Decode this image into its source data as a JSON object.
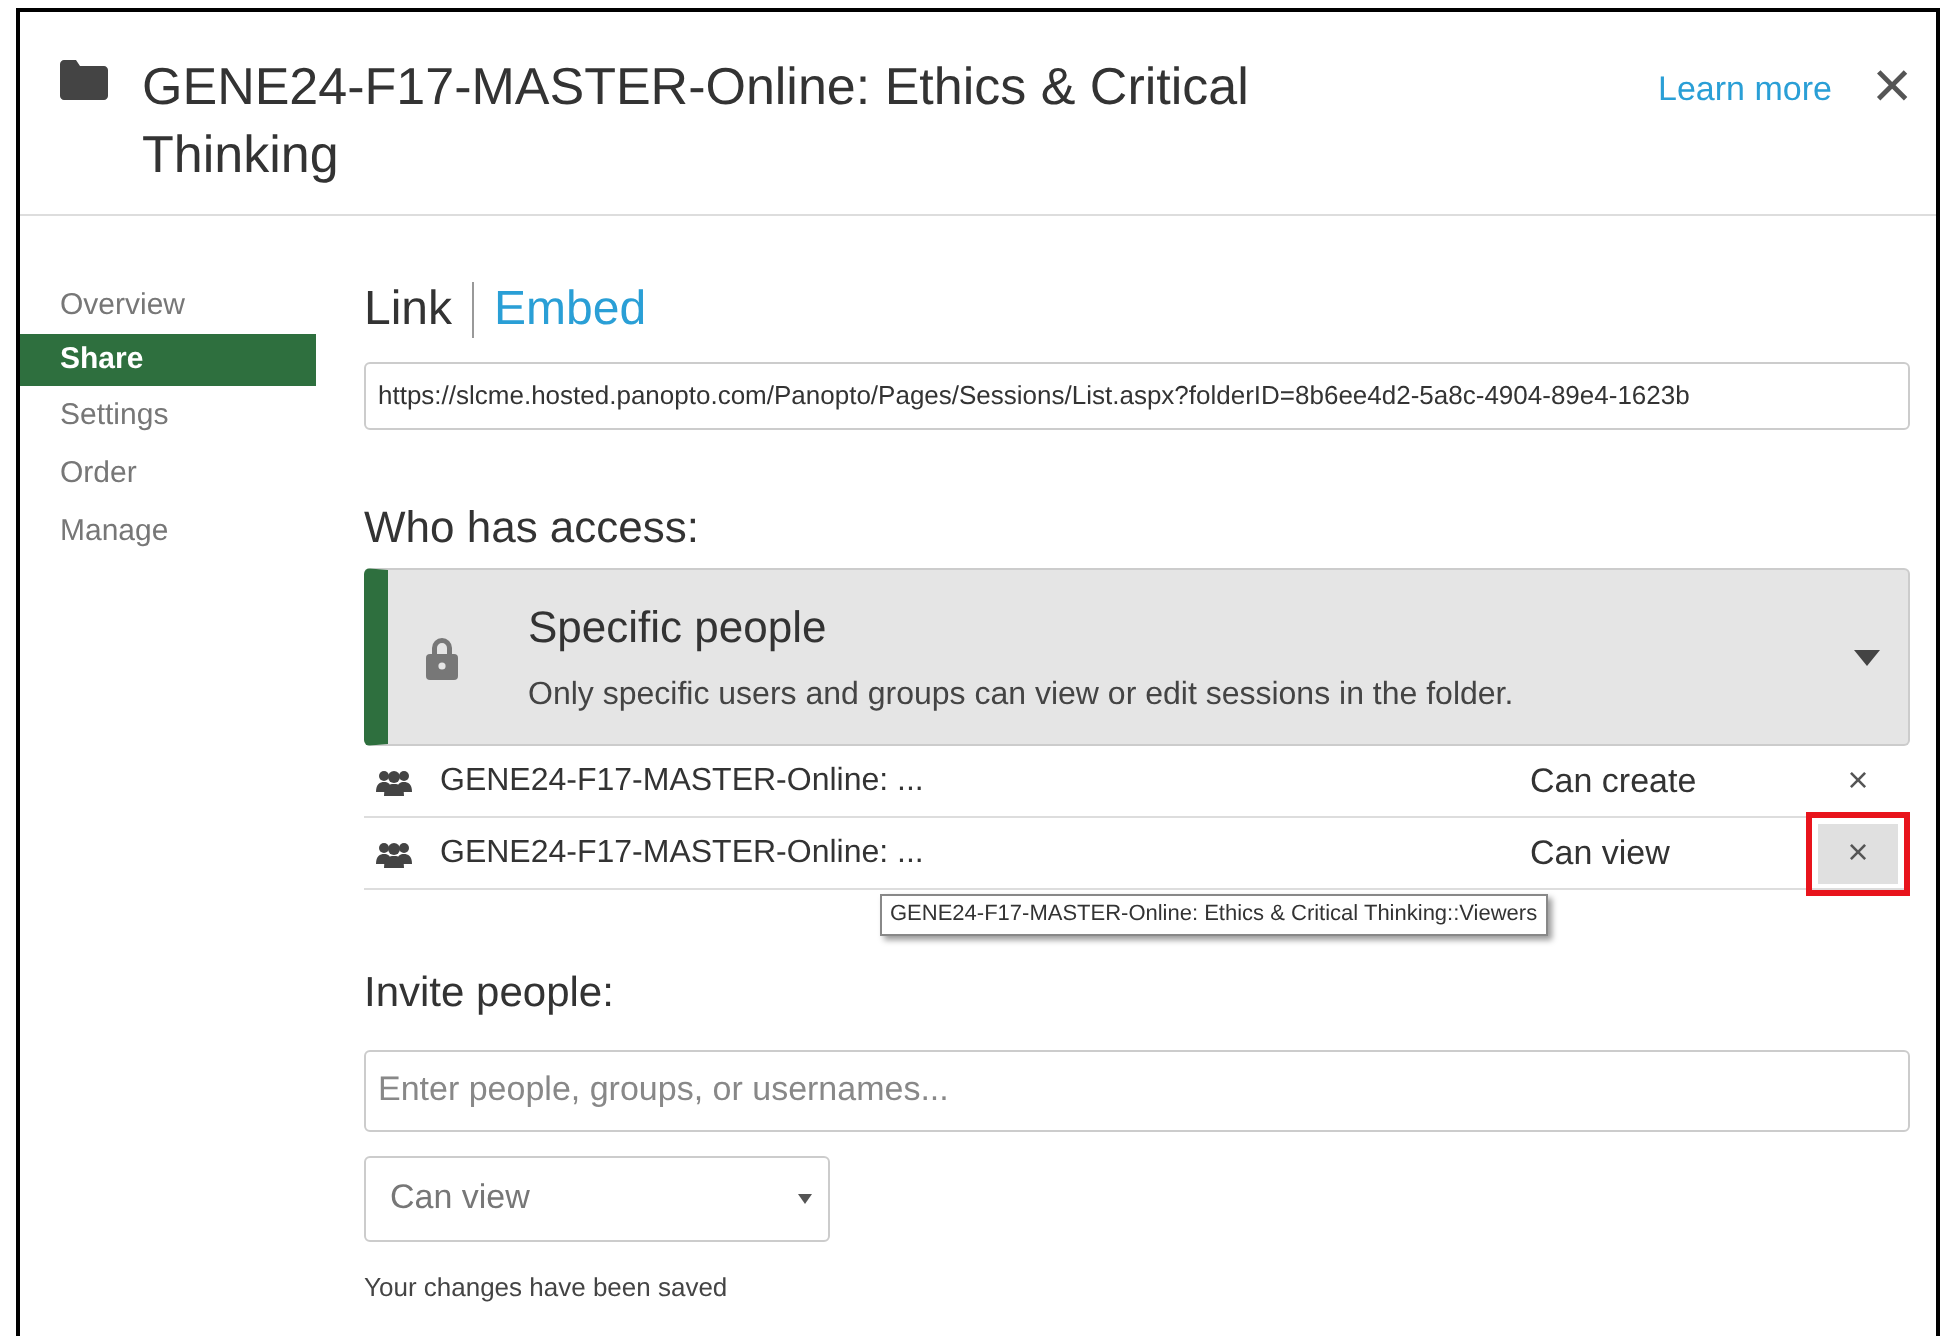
{
  "dialog": {
    "title": "GENE24-F17-MASTER-Online: Ethics & Critical Thinking",
    "learn_more": "Learn more",
    "close": "×"
  },
  "sidebar": {
    "items": [
      {
        "label": "Overview",
        "selected": false
      },
      {
        "label": "Share",
        "selected": true
      },
      {
        "label": "Settings",
        "selected": false
      },
      {
        "label": "Order",
        "selected": false
      },
      {
        "label": "Manage",
        "selected": false
      }
    ]
  },
  "tabs": [
    {
      "label": "Link",
      "selected": true
    },
    {
      "label": "Embed",
      "selected": false
    }
  ],
  "link_field": {
    "value": "https://slcme.hosted.panopto.com/Panopto/Pages/Sessions/List.aspx?folderID=8b6ee4d2-5a8c-4904-89e4-1623b"
  },
  "access": {
    "heading": "Who has access:",
    "title": "Specific people",
    "description": "Only specific users and groups can view or edit sessions in the folder.",
    "entries": [
      {
        "name": "GENE24-F17-MASTER-Online: ...",
        "role": "Can create",
        "remove": "×",
        "highlighted": false
      },
      {
        "name": "GENE24-F17-MASTER-Online: ...",
        "role": "Can view",
        "remove": "×",
        "highlighted": true
      }
    ],
    "tooltip": "GENE24-F17-MASTER-Online: Ethics & Critical Thinking::Viewers"
  },
  "invite": {
    "heading": "Invite people:",
    "placeholder": "Enter people, groups, or usernames...",
    "permission": "Can view",
    "status": "Your changes have been saved"
  }
}
